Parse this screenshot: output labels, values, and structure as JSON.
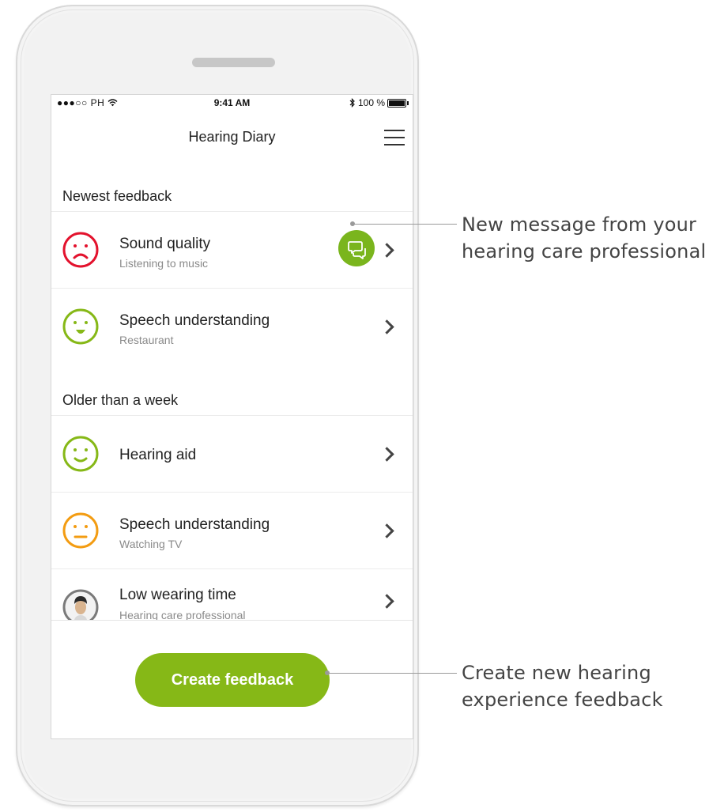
{
  "status_bar": {
    "carrier": "●●●○○ PH",
    "time": "9:41 AM",
    "battery_text": "100 %"
  },
  "header": {
    "title": "Hearing Diary"
  },
  "sections": {
    "newest": {
      "label": "Newest feedback",
      "items": [
        {
          "title": "Sound quality",
          "subtitle": "Listening to music",
          "mood": "sad",
          "color": "#e3122d"
        },
        {
          "title": "Speech understanding",
          "subtitle": "Restaurant",
          "mood": "happy",
          "color": "#86b817"
        }
      ]
    },
    "older": {
      "label": "Older than a week",
      "items": [
        {
          "title": "Hearing aid",
          "subtitle": "",
          "mood": "smile",
          "color": "#86b817"
        },
        {
          "title": "Speech understanding",
          "subtitle": "Watching TV",
          "mood": "neutral",
          "color": "#f39c12"
        },
        {
          "title": "Low wearing time",
          "subtitle": "Hearing care professional",
          "mood": "avatar",
          "color": "#888888"
        }
      ]
    }
  },
  "create_button": {
    "label": "Create feedback"
  },
  "callouts": {
    "message": {
      "line1": "New message from your",
      "line2": "hearing care professional"
    },
    "create": {
      "line1": "Create new hearing",
      "line2": "experience feedback"
    }
  },
  "colors": {
    "accent_green": "#86b817",
    "alert_red": "#e3122d",
    "warning_orange": "#f39c12"
  }
}
